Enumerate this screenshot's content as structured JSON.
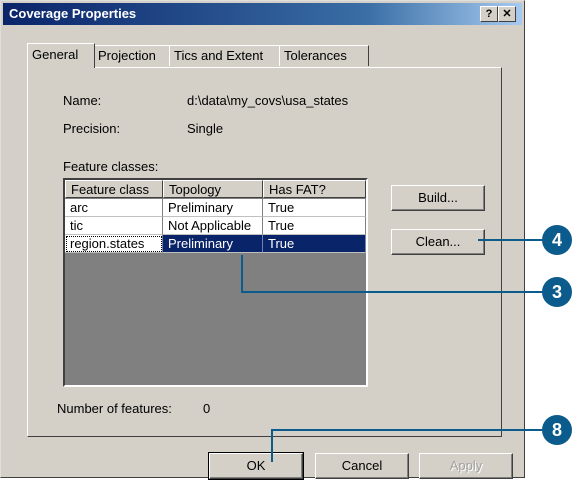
{
  "window": {
    "title": "Coverage Properties",
    "help_btn": "?",
    "close_btn": "✕"
  },
  "tabs": [
    {
      "label": "General",
      "active": true
    },
    {
      "label": "Projection",
      "active": false
    },
    {
      "label": "Tics and Extent",
      "active": false
    },
    {
      "label": "Tolerances",
      "active": false
    }
  ],
  "general": {
    "name_label": "Name:",
    "name_value": "d:\\data\\my_covs\\usa_states",
    "precision_label": "Precision:",
    "precision_value": "Single",
    "feature_classes_label": "Feature classes:",
    "number_of_features_label": "Number of features:",
    "number_of_features_value": "0"
  },
  "feature_table": {
    "columns": [
      "Feature class",
      "Topology",
      "Has FAT?"
    ],
    "rows": [
      {
        "feature_class": "arc",
        "topology": "Preliminary",
        "has_fat": "True",
        "selected": false
      },
      {
        "feature_class": "tic",
        "topology": "Not Applicable",
        "has_fat": "True",
        "selected": false
      },
      {
        "feature_class": "region.states",
        "topology": "Preliminary",
        "has_fat": "True",
        "selected": true
      }
    ]
  },
  "buttons": {
    "build": "Build...",
    "clean": "Clean...",
    "ok": "OK",
    "cancel": "Cancel",
    "apply": "Apply"
  },
  "callouts": {
    "clean": "4",
    "table": "3",
    "ok": "8"
  },
  "colors": {
    "callout": "#0b5b8c",
    "selection": "#0a246a",
    "titlebar": "#0a246a"
  }
}
